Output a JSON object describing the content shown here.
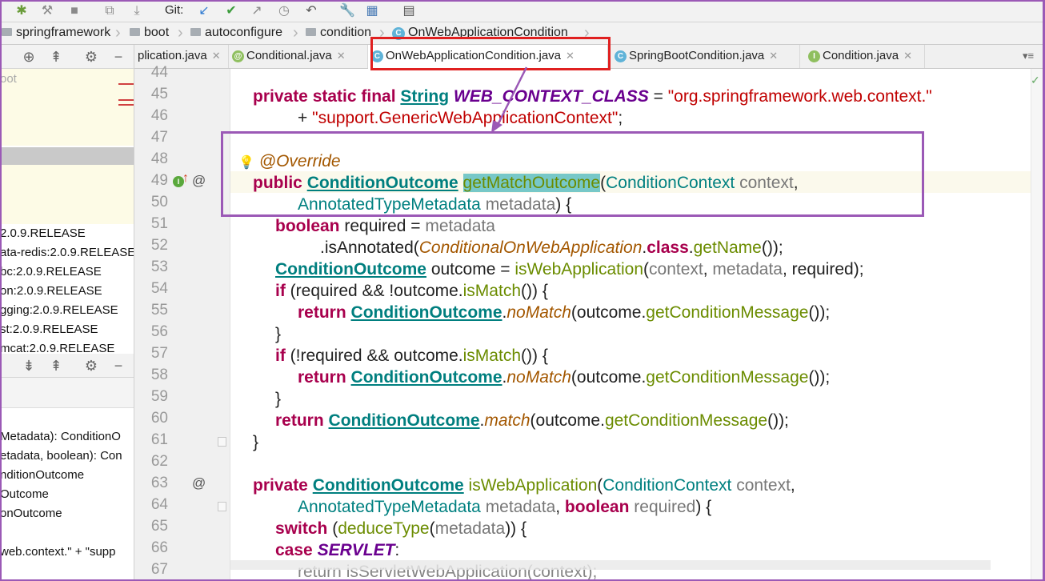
{
  "toolbar": {
    "git_label": "Git:"
  },
  "breadcrumbs": [
    {
      "label": "springframework"
    },
    {
      "label": "boot"
    },
    {
      "label": "autoconfigure"
    },
    {
      "label": "condition"
    },
    {
      "label": "OnWebApplicationCondition"
    }
  ],
  "tabs": [
    {
      "label": "plication.java",
      "icon": "c-icon"
    },
    {
      "label": "Conditional.java",
      "icon": "annotation-icon"
    },
    {
      "label": "OnWebApplicationCondition.java",
      "icon": "c-icon",
      "active": true
    },
    {
      "label": "SpringBootCondition.java",
      "icon": "c-icon"
    },
    {
      "label": "Condition.java",
      "icon": "i-icon"
    }
  ],
  "left_panel": {
    "top_label": "oot",
    "libraries": [
      "2.0.9.RELEASE",
      "ata-redis:2.0.9.RELEASE",
      "bc:2.0.9.RELEASE",
      "on:2.0.9.RELEASE",
      "gging:2.0.9.RELEASE",
      "st:2.0.9.RELEASE",
      "mcat:2.0.9.RELEASE"
    ],
    "structure": [
      "Metadata): ConditionO",
      "etadata, boolean): Con",
      "nditionOutcome",
      "Outcome",
      "onOutcome"
    ],
    "bottom": "web.context.\" + \"supp"
  },
  "code": {
    "line_numbers": [
      "44",
      "45",
      "46",
      "47",
      "48",
      "49",
      "50",
      "51",
      "52",
      "53",
      "54",
      "55",
      "56",
      "57",
      "58",
      "59",
      "60",
      "61",
      "62",
      "63",
      "64",
      "65",
      "66",
      "67"
    ],
    "l45_kw": "private static final",
    "l45_type": "String",
    "l45_const": "WEB_CONTEXT_CLASS",
    "l45_str": "\"org.springframework.web.context.\"",
    "l46_str": "\"support.GenericWebApplicationContext\"",
    "l48_ann": "@Override",
    "l49_kw": "public",
    "t_outcome": "ConditionOutcome",
    "l49_method": "getMatchOutcome",
    "t_context": "ConditionContext",
    "p_context": "context",
    "t_meta": "AnnotatedTypeMetadata",
    "p_metadata": "metadata",
    "kw_boolean": "boolean",
    "p_required": "required",
    "l52_is": ".isAnnotated(",
    "l52_cls": "ConditionalOnWebApplication",
    "l52_class": "class",
    "l52_getname": "getName",
    "v_outcome": "outcome",
    "m_isweb": "isWebApplication",
    "kw_if": "if",
    "m_ismatch": "isMatch",
    "kw_return": "return",
    "m_nomatch": "noMatch",
    "m_match": "match",
    "m_getmsg": "getConditionMessage",
    "kw_private": "private",
    "kw_switch": "switch",
    "m_deduce": "deduceType",
    "kw_case": "case",
    "c_servlet": "SERVLET",
    "l67_text": "return isServletWebApplication(context);"
  }
}
